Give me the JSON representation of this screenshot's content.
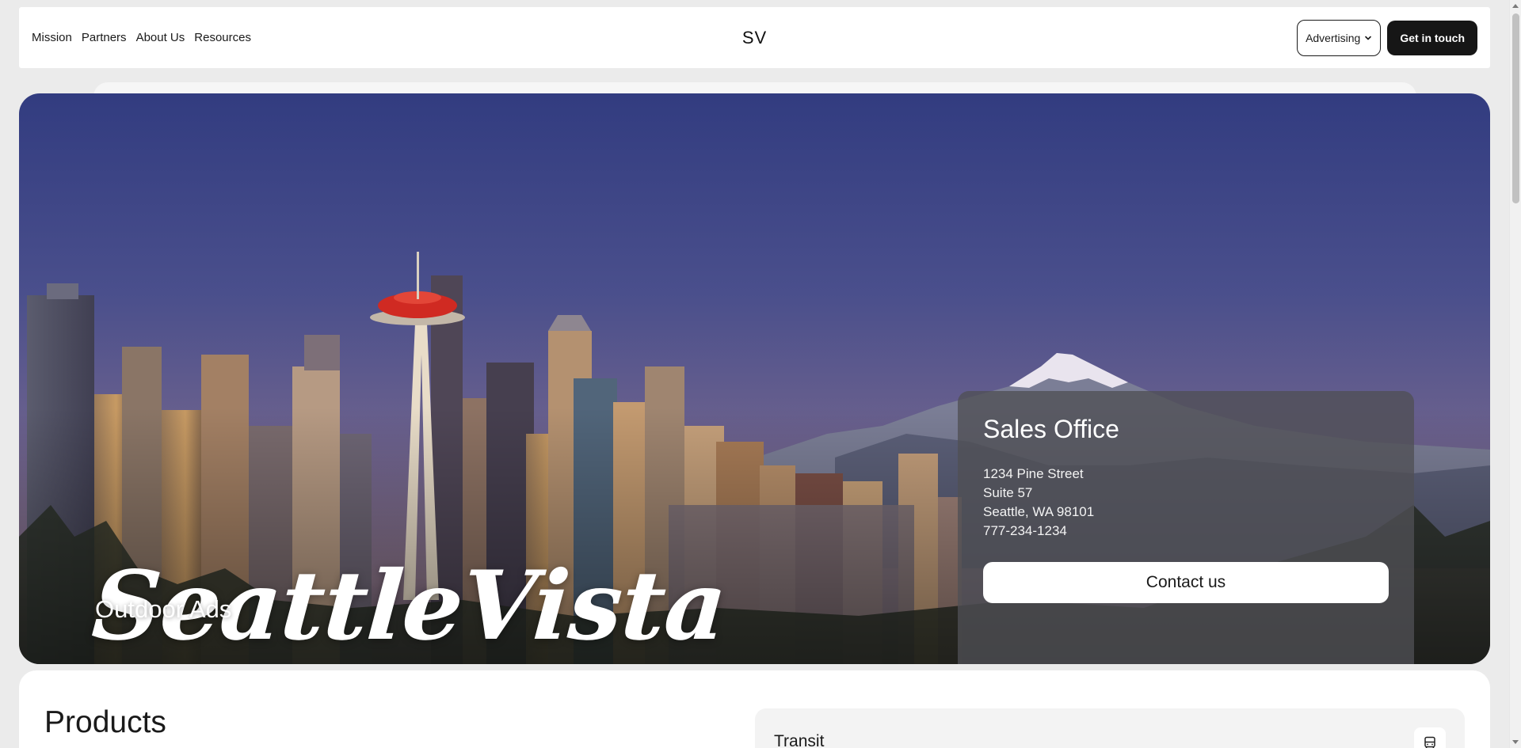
{
  "nav": {
    "links": [
      "Mission",
      "Partners",
      "About Us",
      "Resources"
    ],
    "brand": "SV",
    "dropdown_label": "Advertising",
    "cta_label": "Get in touch"
  },
  "hero": {
    "title": "SeattleVista",
    "subtitle": "Outdoor Ads"
  },
  "sales": {
    "title": "Sales Office",
    "address": [
      "1234 Pine Street",
      "Suite 57",
      "Seattle, WA 98101"
    ],
    "phone": "777-234-1234",
    "button_label": "Contact us"
  },
  "products": {
    "title": "Products",
    "first_item": "Transit"
  },
  "colors": {
    "page_bg": "#ebebeb",
    "cta_bg": "#161616",
    "card_overlay": "#505055"
  },
  "icons": {
    "dropdown": "chevron-down-icon",
    "transit": "bus-icon"
  }
}
